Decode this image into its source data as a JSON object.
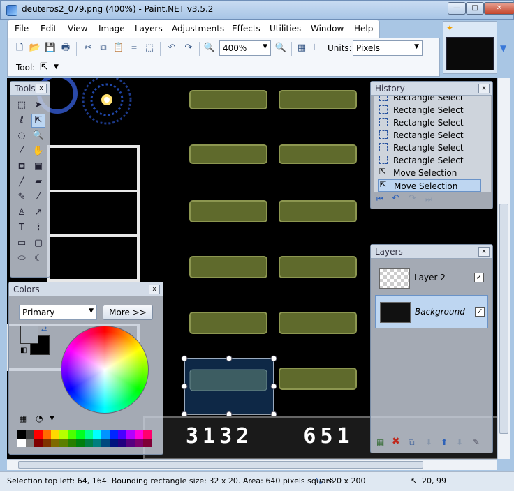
{
  "window": {
    "title": "deuteros2_079.png (400%) - Paint.NET v3.5.2",
    "minimize_label": "—",
    "maximize_label": "□",
    "close_label": "✕"
  },
  "menu": [
    "File",
    "Edit",
    "View",
    "Image",
    "Layers",
    "Adjustments",
    "Effects",
    "Utilities",
    "Window",
    "Help"
  ],
  "toolbar": {
    "zoom_value": "400%",
    "units_label": "Units:",
    "units_value": "Pixels",
    "tool_label": "Tool:"
  },
  "canvas": {
    "score_text": "3132   651"
  },
  "tools_panel": {
    "title": "Tools",
    "close": "x"
  },
  "colors_panel": {
    "title": "Colors",
    "close": "x",
    "mode_value": "Primary",
    "more_button": "More >>",
    "palette": [
      "#000000",
      "#404040",
      "#ff0000",
      "#ff6a00",
      "#ffd800",
      "#b6ff00",
      "#4cff00",
      "#00ff21",
      "#00ff90",
      "#00ffff",
      "#0094ff",
      "#0026ff",
      "#4800ff",
      "#b200ff",
      "#ff00dc",
      "#ff006e",
      "#ffffff",
      "#808080",
      "#7f0000",
      "#7f3300",
      "#7f6a00",
      "#5b7f00",
      "#267f00",
      "#007f0e",
      "#007f46",
      "#007f7f",
      "#004a7f",
      "#00137f",
      "#21007f",
      "#57007f",
      "#7f006e",
      "#7f0037"
    ]
  },
  "history_panel": {
    "title": "History",
    "close": "x",
    "items": [
      "Rectangle Select",
      "Rectangle Select",
      "Rectangle Select",
      "Rectangle Select",
      "Rectangle Select",
      "Rectangle Select",
      "Move Selection",
      "Move Selection"
    ]
  },
  "layers_panel": {
    "title": "Layers",
    "close": "x",
    "layers": [
      {
        "name": "Layer 2",
        "checked": "✓"
      },
      {
        "name": "Background",
        "checked": "✓"
      }
    ]
  },
  "status": {
    "selection": "Selection top left: 64, 164. Bounding rectangle size: 32 x 20. Area: 640 pixels square",
    "image_size": "320 x 200",
    "cursor_pos": "20, 99"
  }
}
